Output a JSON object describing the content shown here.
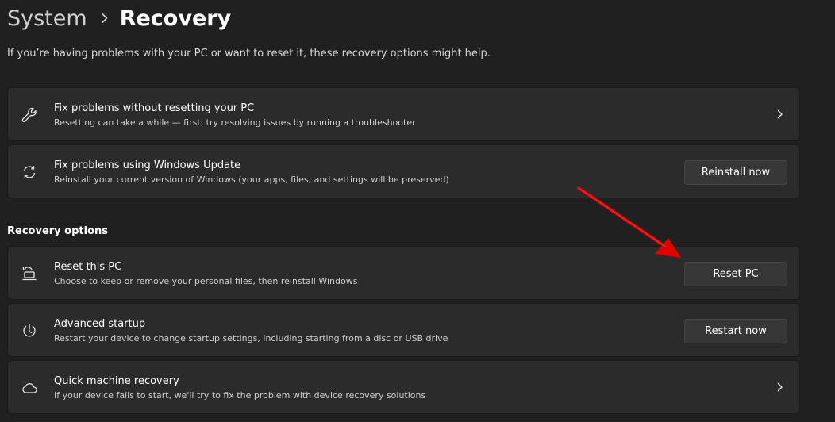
{
  "breadcrumb": {
    "parent": "System",
    "current": "Recovery"
  },
  "intro": "If you’re having problems with your PC or want to reset it, these recovery options might help.",
  "cards_top": [
    {
      "icon": "wrench-icon",
      "title": "Fix problems without resetting your PC",
      "description": "Resetting can take a while — first, try resolving issues by running a troubleshooter",
      "action": "chevron"
    },
    {
      "icon": "sync-icon",
      "title": "Fix problems using Windows Update",
      "description": "Reinstall your current version of Windows (your apps, files, and settings will be preserved)",
      "button_label": "Reinstall now"
    }
  ],
  "section_title": "Recovery options",
  "cards_recovery": [
    {
      "icon": "reset-pc-icon",
      "title": "Reset this PC",
      "description": "Choose to keep or remove your personal files, then reinstall Windows",
      "button_label": "Reset PC"
    },
    {
      "icon": "power-restart-icon",
      "title": "Advanced startup",
      "description": "Restart your device to change startup settings, including starting from a disc or USB drive",
      "button_label": "Restart now"
    },
    {
      "icon": "cloud-icon",
      "title": "Quick machine recovery",
      "description": "If your device fails to start, we'll try to fix the problem with device recovery solutions",
      "action": "chevron"
    }
  ],
  "colors": {
    "background": "#202020",
    "card": "#2b2b2b",
    "button": "#373737",
    "annotation_arrow": "#e00000"
  }
}
